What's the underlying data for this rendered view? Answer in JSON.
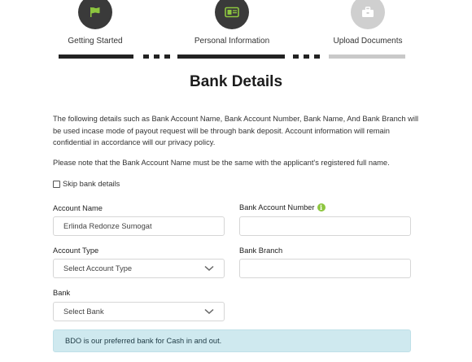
{
  "stepper": {
    "steps": [
      {
        "label": "Getting Started",
        "icon": "flag-icon",
        "state": "done"
      },
      {
        "label": "Personal Information",
        "icon": "id-card-icon",
        "state": "current"
      },
      {
        "label": "Upload Documents",
        "icon": "briefcase-icon",
        "state": "pending"
      }
    ]
  },
  "page": {
    "title": "Bank Details",
    "intro": "The following details such as Bank Account Name, Bank Account Number, Bank Name, And Bank Branch will be used incase mode of payout request will be through bank deposit. Account information will remain confidential in accordance will our privacy policy.",
    "note": "Please note that the Bank Account Name must be the same with the applicant's registered full name.",
    "skip_label": "Skip bank details"
  },
  "form": {
    "account_name": {
      "label": "Account Name",
      "value": "Erlinda Redonze Sumogat"
    },
    "account_number": {
      "label": "Bank Account Number",
      "value": ""
    },
    "account_type": {
      "label": "Account Type",
      "selected": "Select Account Type"
    },
    "bank_branch": {
      "label": "Bank Branch",
      "value": ""
    },
    "bank": {
      "label": "Bank",
      "selected": "Select Bank"
    }
  },
  "alert": {
    "text": "BDO is our preferred bank for Cash in and out."
  },
  "colors": {
    "accent_green": "#8dc63f",
    "step_dark": "#3a3a3a",
    "step_light": "#cfcfcf",
    "alert_bg": "#cfe9ef"
  }
}
